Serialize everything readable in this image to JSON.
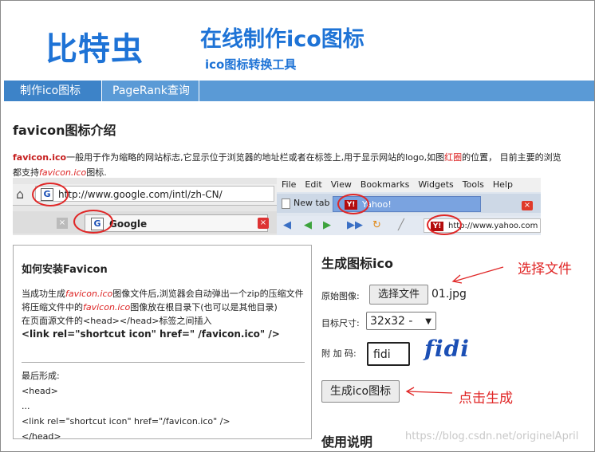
{
  "header": {
    "logo": "比特虫",
    "site_title": "在线制作ico图标",
    "subtitle": "ico图标转换工具"
  },
  "nav": {
    "tabs": [
      "制作ico图标",
      "PageRank查询"
    ]
  },
  "intro": {
    "heading": "favicon图标介绍",
    "line1_a": "favicon.ico",
    "line1_b": "一般用于作为缩略的网站标志,它显示位于浏览器的地址栏或者在标签上,用于显示网站的logo,如图",
    "line1_c": "红圈",
    "line1_d": "的位置，  目前主要的浏览",
    "line2_a": "都支持",
    "line2_b": "favicon.ico",
    "line2_c": "图标."
  },
  "screens": {
    "google_url": "http://www.google.com/intl/zh-CN/",
    "google_tab": "Google",
    "menu": [
      "File",
      "Edit",
      "View",
      "Bookmarks",
      "Widgets",
      "Tools",
      "Help"
    ],
    "new_tab": "New tab",
    "yahoo_tab": "Yahoo!",
    "yahoo_url": "http://www.yahoo.com"
  },
  "install": {
    "title": "如何安装Favicon",
    "p1_a": "当成功生成",
    "p1_b": "favicon.ico",
    "p1_c": "图像文件后,浏览器会自动弹出一个zip的压缩文件",
    "p2_a": "将压缩文件中的",
    "p2_b": "favicon.ico",
    "p2_c": "图像放在根目录下(也可以是其他目录)",
    "p3": "在页面源文件的<head></head>标签之间插入",
    "p4": "<link rel=\"shortcut icon\" href=\" /favicon.ico\" />",
    "final_label": "最后形成:",
    "code1": "<head>",
    "code2": "...",
    "code3": "<link rel=\"shortcut icon\" href=\"/favicon.ico\" />",
    "code4": "</head>"
  },
  "generator": {
    "title": "生成图标ico",
    "source_label": "原始图像:",
    "choose_file": "选择文件",
    "file_name": "01.jpg",
    "size_label": "目标尺寸:",
    "size_value": "32x32 -",
    "code_label": "附 加 码:",
    "code_value": "fidi",
    "captcha": "fidi",
    "generate": "生成ico图标",
    "usage": "使用说明"
  },
  "annotations": {
    "select_file": "选择文件",
    "click_generate": "点击生成"
  },
  "watermark": "https://blog.csdn.net/originelApril",
  "colors": {
    "brand_blue": "#1e73d6",
    "nav_bar": "#5a9ad6",
    "annotation_red": "#e02626"
  }
}
